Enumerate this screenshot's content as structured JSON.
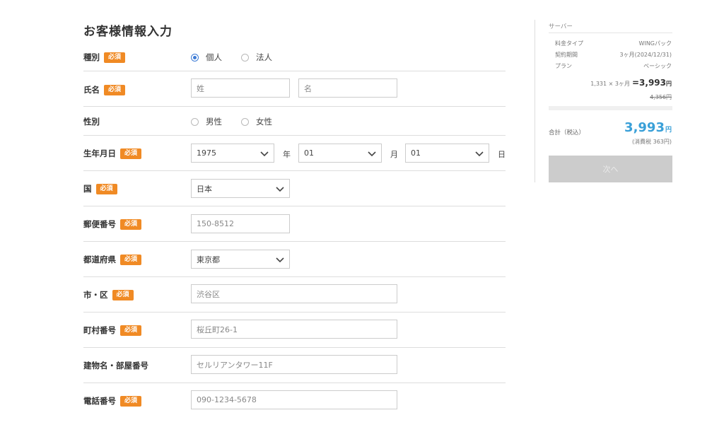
{
  "page_title": "お客様情報入力",
  "required_badge": "必須",
  "form": {
    "type": {
      "label": "種別",
      "options": [
        "個人",
        "法人"
      ],
      "selected_index": 0
    },
    "name": {
      "label": "氏名",
      "last_placeholder": "姓",
      "first_placeholder": "名"
    },
    "gender": {
      "label": "性別",
      "options": [
        "男性",
        "女性"
      ],
      "selected_index": -1
    },
    "birthdate": {
      "label": "生年月日",
      "year": "1975",
      "year_unit": "年",
      "month": "01",
      "month_unit": "月",
      "day": "01",
      "day_unit": "日"
    },
    "country": {
      "label": "国",
      "value": "日本"
    },
    "postal": {
      "label": "郵便番号",
      "placeholder": "150-8512"
    },
    "prefecture": {
      "label": "都道府県",
      "value": "東京都"
    },
    "city": {
      "label": "市・区",
      "placeholder": "渋谷区"
    },
    "town": {
      "label": "町村番号",
      "placeholder": "桜丘町26-1"
    },
    "building": {
      "label": "建物名・部屋番号",
      "placeholder": "セルリアンタワー11F"
    },
    "phone": {
      "label": "電話番号",
      "placeholder": "090-1234-5678"
    }
  },
  "sidebar": {
    "title": "サーバー",
    "rows": [
      {
        "key": "料金タイプ",
        "value": "WINGパック"
      },
      {
        "key": "契約期間",
        "value": "3ヶ月(2024/12/31)"
      },
      {
        "key": "プラン",
        "value": "ベーシック"
      }
    ],
    "calc_text": "1,331 × 3ヶ月",
    "calc_result": "=3,993",
    "calc_yen": "円",
    "strike_price": "4,356円",
    "total_label": "合計（税込）",
    "total_value": "3,993",
    "total_yen": "円",
    "tax_note": "(消費税 363円)",
    "next_button": "次へ"
  },
  "colors": {
    "required": "#f08a24",
    "accent": "#3aa0d8",
    "radio": "#3c7bd6",
    "disabled": "#cccccc"
  }
}
